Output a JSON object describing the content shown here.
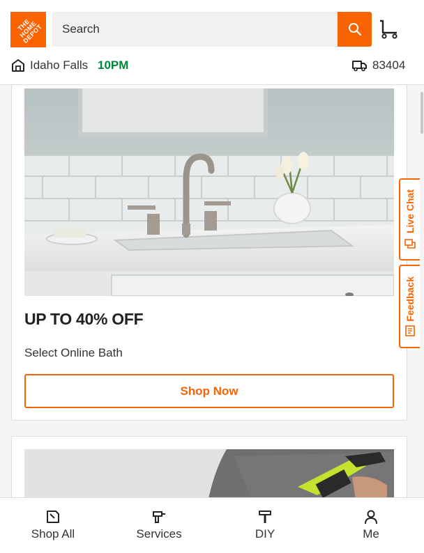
{
  "header": {
    "logo_text": "THE HOME DEPOT",
    "search": {
      "placeholder": "Search"
    },
    "store": {
      "name": "Idaho Falls",
      "hours": "10PM"
    },
    "delivery": {
      "zip": "83404"
    }
  },
  "promo": {
    "title": "UP TO 40% OFF",
    "subtitle": "Select Online Bath",
    "cta_label": "Shop Now"
  },
  "side_tabs": {
    "live_chat": "Live Chat",
    "feedback": "Feedback"
  },
  "bottom_nav": {
    "items": [
      {
        "label": "Shop All",
        "icon": "shop-all-icon"
      },
      {
        "label": "Services",
        "icon": "drill-icon"
      },
      {
        "label": "DIY",
        "icon": "hammer-icon"
      },
      {
        "label": "Me",
        "icon": "person-icon"
      }
    ]
  },
  "colors": {
    "brand": "#f96302",
    "store_hours": "#00873c"
  }
}
